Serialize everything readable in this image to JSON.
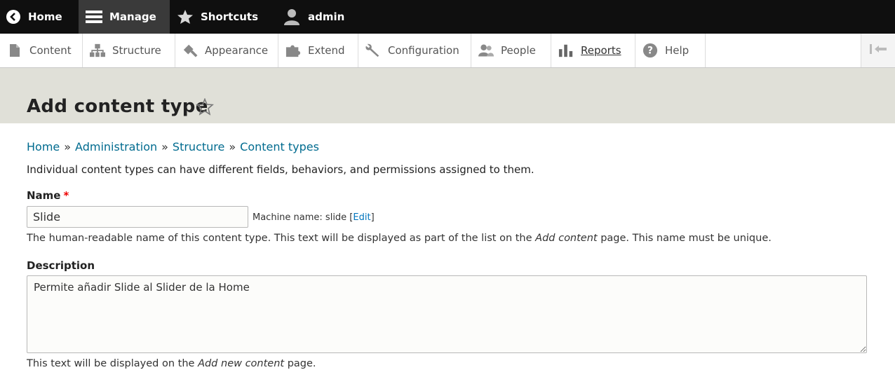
{
  "toolbar": {
    "home": "Home",
    "manage": "Manage",
    "shortcuts": "Shortcuts",
    "user": "admin"
  },
  "tray": {
    "items": [
      {
        "label": "Content",
        "icon": "file-icon"
      },
      {
        "label": "Structure",
        "icon": "structure-icon"
      },
      {
        "label": "Appearance",
        "icon": "paintbrush-icon"
      },
      {
        "label": "Extend",
        "icon": "puzzle-icon"
      },
      {
        "label": "Configuration",
        "icon": "wrench-icon"
      },
      {
        "label": "People",
        "icon": "people-icon"
      },
      {
        "label": "Reports",
        "icon": "bar-chart-icon"
      },
      {
        "label": "Help",
        "icon": "help-icon"
      }
    ]
  },
  "page": {
    "title": "Add content type"
  },
  "breadcrumb": [
    "Home",
    "Administration",
    "Structure",
    "Content types"
  ],
  "breadcrumb_sep": "»",
  "intro": "Individual content types can have different fields, behaviors, and permissions assigned to them.",
  "form": {
    "name_label": "Name",
    "name_required": "*",
    "name_value": "Slide",
    "machine_prefix": "Machine name: slide [",
    "machine_edit": "Edit",
    "machine_suffix": "]",
    "name_help_1": "The human-readable name of this content type. This text will be displayed as part of the list on the ",
    "name_help_em": "Add content",
    "name_help_2": " page. This name must be unique.",
    "desc_label": "Description",
    "desc_value": "Permite añadir Slide al Slider de la Home",
    "desc_help_1": "This text will be displayed on the ",
    "desc_help_em": "Add new content",
    "desc_help_2": " page."
  },
  "colors": {
    "toolbar_bg": "#0f0f0f",
    "header_bg": "#e0e0d8",
    "link": "#006b8f",
    "required": "#e00000"
  }
}
